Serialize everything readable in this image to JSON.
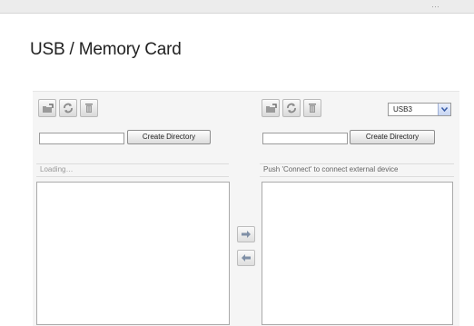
{
  "page": {
    "title": "USB / Memory Card"
  },
  "left_panel": {
    "create_dir_label": "Create Directory",
    "dir_input_value": "",
    "status_text": "Loading…",
    "toolbar_icons": [
      "upload-folder-icon",
      "refresh-icon",
      "trash-icon"
    ]
  },
  "right_panel": {
    "create_dir_label": "Create Directory",
    "dir_input_value": "",
    "status_text": "Push 'Connect' to connect external device",
    "device_select": {
      "selected": "USB3"
    },
    "toolbar_icons": [
      "upload-folder-icon",
      "refresh-icon",
      "trash-icon"
    ]
  },
  "transfer": {
    "right_arrow_icon": "arrow-right-icon",
    "left_arrow_icon": "arrow-left-icon"
  },
  "colors": {
    "arrow": "#7f8fa6",
    "icon": "#8a8a8a"
  }
}
